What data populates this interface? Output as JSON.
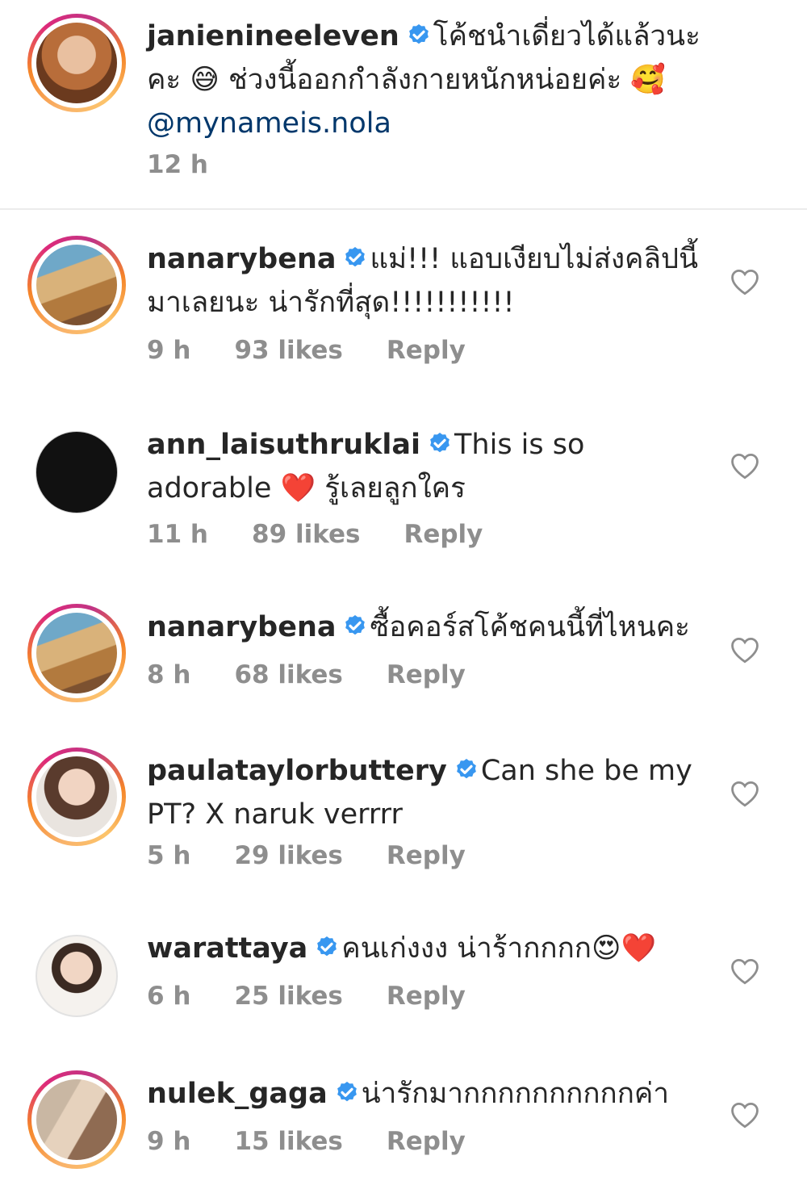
{
  "caption": {
    "username": "janienineeleven",
    "text": "โค้ชนำเดี่ยวได้แล้วนะคะ 😅 ช่วงนี้ออกกำลังกายหนักหน่อยค่ะ 🥰",
    "mention": "@mynameis.nola",
    "time": "12 h"
  },
  "comments": [
    {
      "username": "nanarybena",
      "text": "แม่!!! แอบเงียบไม่ส่งคลิปนี้มาเลยนะ น่ารักที่สุด!!!!!!!!!!!",
      "time": "9 h",
      "likes": "93 likes",
      "reply": "Reply"
    },
    {
      "username": "ann_laisuthruklai",
      "text": "This is so adorable ❤️ รู้เลยลูกใคร",
      "time": "11 h",
      "likes": "89 likes",
      "reply": "Reply"
    },
    {
      "username": "nanarybena",
      "text": "ซื้อคอร์สโค้ชคนนี้ที่ไหนคะ",
      "time": "8 h",
      "likes": "68 likes",
      "reply": "Reply"
    },
    {
      "username": "paulataylorbuttery",
      "text": "Can she be my PT? X naruk verrrr",
      "time": "5 h",
      "likes": "29 likes",
      "reply": "Reply"
    },
    {
      "username": "warattaya",
      "text": "คนเก่งงง น่าร้ากกกก😍❤️",
      "time": "6 h",
      "likes": "25 likes",
      "reply": "Reply"
    },
    {
      "username": "nulek_gaga",
      "text": "น่ารักมากกกกกกกกกกค่า",
      "time": "9 h",
      "likes": "15 likes",
      "reply": "Reply"
    }
  ],
  "colors": {
    "verified": "#3897f0",
    "text": "#262626",
    "meta": "#8e8e8e",
    "mention": "#00376b"
  }
}
